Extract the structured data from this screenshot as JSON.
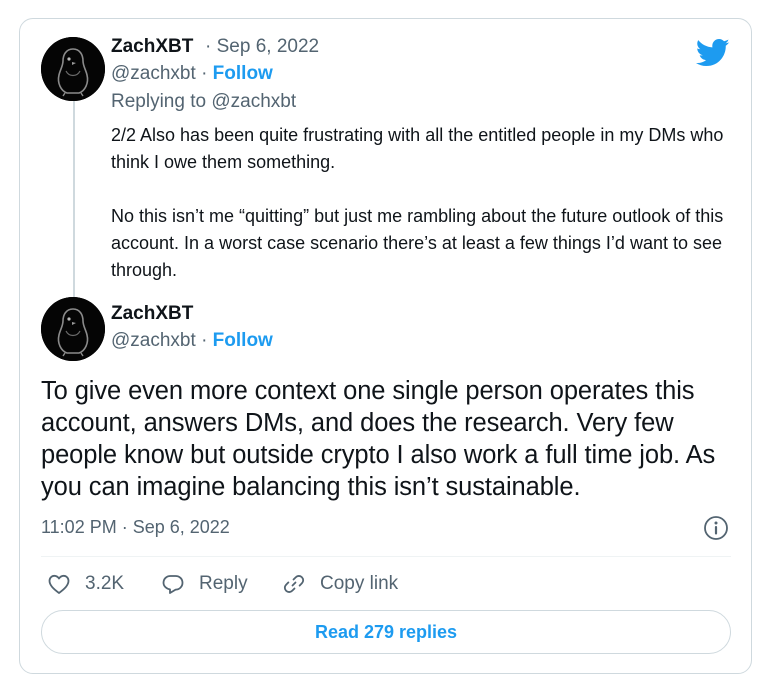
{
  "brand": {
    "accent_color": "#1d9bf0",
    "icon": "twitter-bird-icon"
  },
  "reply_tweet": {
    "author_name": "ZachXBT",
    "separator": "·",
    "date": "Sep 6, 2022",
    "handle": "@zachxbt",
    "follow_label": "Follow",
    "replying_to": "Replying to @zachxbt",
    "paragraphs": [
      "2/2 Also has been quite frustrating with all the entitled people in my DMs who think I owe them something.",
      "No this isn’t me “quitting” but just me rambling about the future outlook of this account. In a worst case scenario there’s at least a few things I’d want to see through."
    ]
  },
  "main_tweet": {
    "author_name": "ZachXBT",
    "handle": "@zachxbt",
    "separator": "·",
    "follow_label": "Follow",
    "text": "To give even more context one single person operates this account, answers DMs, and does the research. Very few people know but outside crypto I also work a full time job. As you can imagine balancing this isn’t sustainable.",
    "timestamp": "11:02 PM · Sep 6, 2022"
  },
  "actions": {
    "like_count": "3.2K",
    "reply_label": "Reply",
    "copy_link_label": "Copy link"
  },
  "read_replies_label": "Read 279 replies"
}
